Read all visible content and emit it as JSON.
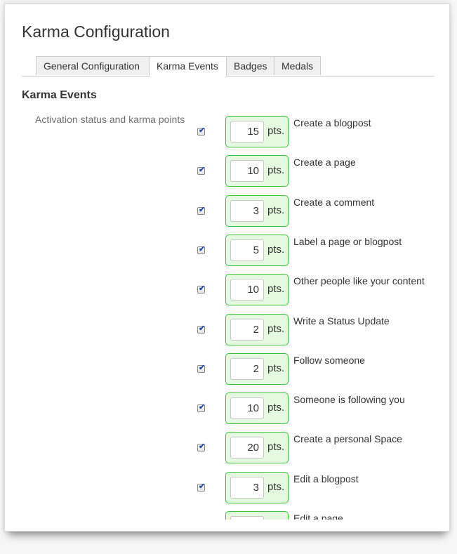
{
  "page": {
    "title": "Karma Configuration"
  },
  "tabs": [
    {
      "label": "General Configuration",
      "active": false
    },
    {
      "label": "Karma Events",
      "active": true
    },
    {
      "label": "Badges",
      "active": false
    },
    {
      "label": "Medals",
      "active": false
    }
  ],
  "section": {
    "title": "Karma Events",
    "field_label": "Activation status and karma points"
  },
  "unit_label": "pts.",
  "events": [
    {
      "label": "Create a blogpost",
      "points": "15",
      "enabled": true
    },
    {
      "label": "Create a page",
      "points": "10",
      "enabled": true
    },
    {
      "label": "Create a comment",
      "points": "3",
      "enabled": true
    },
    {
      "label": "Label a page or blogpost",
      "points": "5",
      "enabled": true
    },
    {
      "label": "Other people like your content",
      "points": "10",
      "enabled": true
    },
    {
      "label": "Write a Status Update",
      "points": "2",
      "enabled": true
    },
    {
      "label": "Follow someone",
      "points": "2",
      "enabled": true
    },
    {
      "label": "Someone is following you",
      "points": "10",
      "enabled": true
    },
    {
      "label": "Create a personal Space",
      "points": "20",
      "enabled": true
    },
    {
      "label": "Edit a blogpost",
      "points": "3",
      "enabled": true
    },
    {
      "label": "Edit a page",
      "points": "",
      "enabled": true
    }
  ],
  "colors": {
    "points_box_bg": "#e5f9e0",
    "points_box_border": "#3bc23b",
    "checkbox_mark": "#2a4f9e"
  }
}
